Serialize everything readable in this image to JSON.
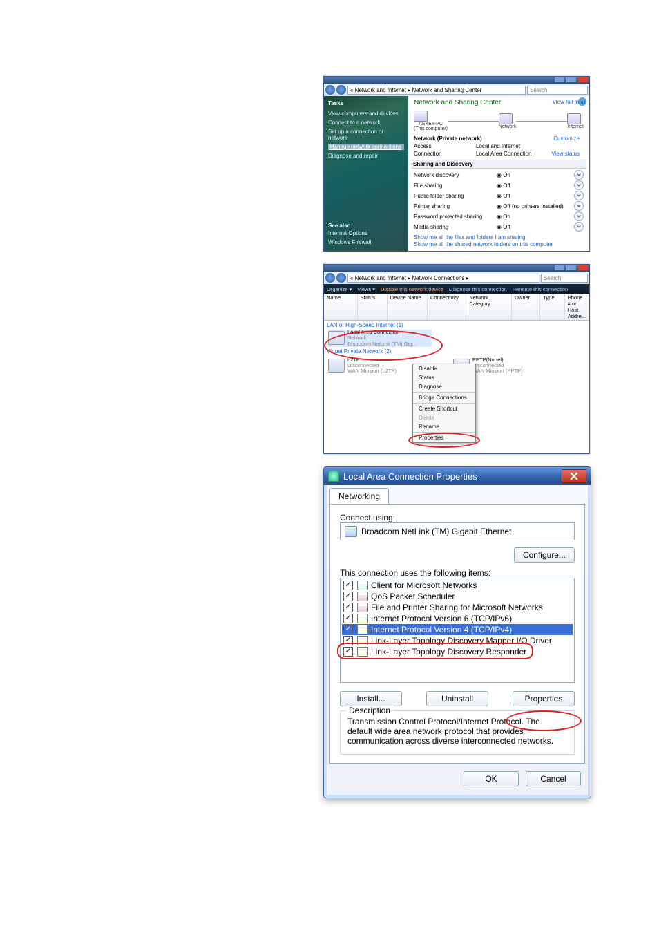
{
  "nsc": {
    "breadcrumb": "« Network and Internet ▸ Network and Sharing Center",
    "search_placeholder": "Search",
    "tasks_header": "Tasks",
    "tasks": [
      "View computers and devices",
      "Connect to a network",
      "Set up a connection or network",
      "Manage network connections",
      "Diagnose and repair"
    ],
    "see_also_header": "See also",
    "see_also": [
      "Internet Options",
      "Windows Firewall"
    ],
    "title": "Network and Sharing Center",
    "view_full_map": "View full map",
    "nodes": {
      "pc": "ASKEY-PC",
      "pc_sub": "(This computer)",
      "net": "Network",
      "inet": "Internet"
    },
    "network_row": "Network (Private network)",
    "customize": "Customize",
    "access_label": "Access",
    "access_value": "Local and Internet",
    "connection_label": "Connection",
    "connection_value": "Local Area Connection",
    "view_status": "View status",
    "sharing_header": "Sharing and Discovery",
    "sd": [
      {
        "k": "Network discovery",
        "v": "◉ On"
      },
      {
        "k": "File sharing",
        "v": "◉ Off"
      },
      {
        "k": "Public folder sharing",
        "v": "◉ Off"
      },
      {
        "k": "Printer sharing",
        "v": "◉ Off (no printers installed)"
      },
      {
        "k": "Password protected sharing",
        "v": "◉ On"
      },
      {
        "k": "Media sharing",
        "v": "◉ Off"
      }
    ],
    "foot1": "Show me all the files and folders I am sharing",
    "foot2": "Show me all the shared network folders on this computer"
  },
  "nc": {
    "breadcrumb": "« Network and Internet ▸ Network Connections ▸",
    "search_placeholder": "Search",
    "cmd": {
      "organize": "Organize ▾",
      "views": "Views ▾",
      "disable": "Disable this network device",
      "diagnose": "Diagnose this connection",
      "rename": "Rename this connection"
    },
    "cols": [
      "Name",
      "Status",
      "Device Name",
      "Connectivity",
      "Network Category",
      "Owner",
      "Type",
      "Phone # or Host Addre..."
    ],
    "grp": "LAN or High-Speed Internet (1)",
    "lac": {
      "name": "Local Area Connection",
      "status": "Network",
      "device": "Broadcom NetLink (TM) Gig..."
    },
    "grp2": "Virtual Private Network (2)",
    "l2tp": {
      "name": "L2TP",
      "status": "Disconnected",
      "device": "WAN Miniport (L2TP)"
    },
    "pptp": {
      "name": "PPTP(Nortel)",
      "status": "Disconnected",
      "device": "WAN Miniport (PPTP)"
    },
    "menu": [
      "Disable",
      "Status",
      "Diagnose",
      "Bridge Connections",
      "Create Shortcut",
      "Delete",
      "Rename",
      "Properties"
    ]
  },
  "lac": {
    "title": "Local Area Connection Properties",
    "tab": "Networking",
    "connect_using": "Connect using:",
    "adapter": "Broadcom NetLink (TM) Gigabit Ethernet",
    "configure": "Configure...",
    "items_label": "This connection uses the following items:",
    "items": [
      {
        "t": "Client for Microsoft Networks",
        "c": "cli"
      },
      {
        "t": "QoS Packet Scheduler",
        "c": "srv"
      },
      {
        "t": "File and Printer Sharing for Microsoft Networks",
        "c": "srv"
      },
      {
        "t": "Internet Protocol Version 6 (TCP/IPv6)",
        "c": "net",
        "strike": true
      },
      {
        "t": "Internet Protocol Version 4 (TCP/IPv4)",
        "c": "net",
        "sel": true
      },
      {
        "t": "Link-Layer Topology Discovery Mapper I/O Driver",
        "c": "net"
      },
      {
        "t": "Link-Layer Topology Discovery Responder",
        "c": "net"
      }
    ],
    "install": "Install...",
    "uninstall": "Uninstall",
    "properties": "Properties",
    "desc_label": "Description",
    "desc": "Transmission Control Protocol/Internet Protocol. The default wide area network protocol that provides communication across diverse interconnected networks.",
    "ok": "OK",
    "cancel": "Cancel"
  }
}
